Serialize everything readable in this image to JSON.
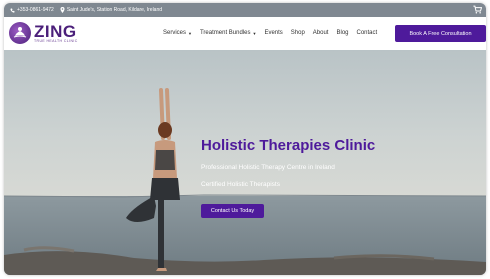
{
  "topbar": {
    "phone": "+353-0861-9472",
    "address": "Saint Jude's, Station Road, Kildare, Ireland",
    "phone_icon": "phone-icon",
    "location_icon": "location-pin-icon",
    "cart_icon": "cart-icon"
  },
  "logo": {
    "name": "ZING",
    "tagline": "TRUE HEALTH CLINIC"
  },
  "nav": {
    "items": [
      {
        "label": "Services",
        "has_dropdown": true
      },
      {
        "label": "Treatment Bundles",
        "has_dropdown": true
      },
      {
        "label": "Events",
        "has_dropdown": false
      },
      {
        "label": "Shop",
        "has_dropdown": false
      },
      {
        "label": "About",
        "has_dropdown": false
      },
      {
        "label": "Blog",
        "has_dropdown": false
      },
      {
        "label": "Contact",
        "has_dropdown": false
      }
    ],
    "cta": "Book A Free Consultation"
  },
  "hero": {
    "title": "Holistic Therapies Clinic",
    "subtitle1": "Professional Holistic Therapy Centre in Ireland",
    "subtitle2": "Certified Holistic Therapists",
    "button": "Contact Us Today"
  },
  "colors": {
    "brand": "#4e1a9b",
    "topbar": "#7f8891"
  }
}
